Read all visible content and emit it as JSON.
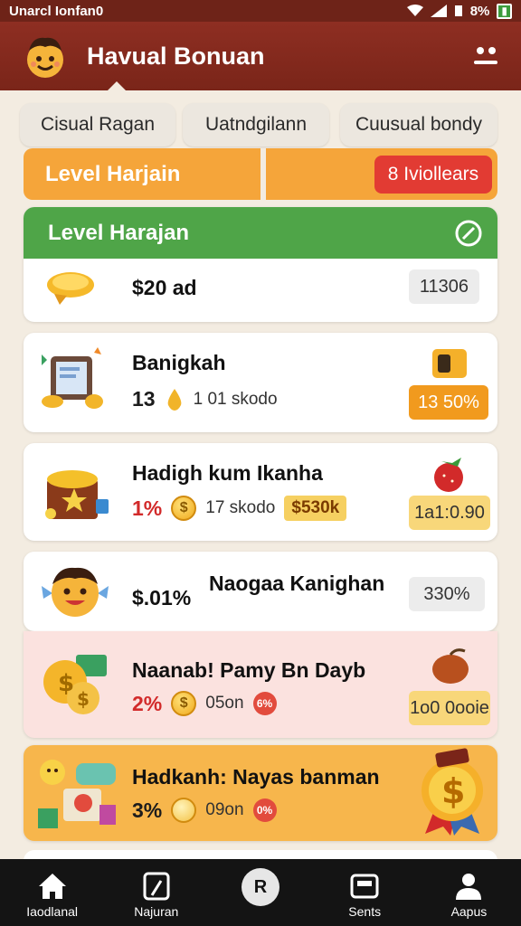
{
  "status_bar": {
    "carrier": "Unarcl Ionfan0",
    "battery": "8%"
  },
  "app": {
    "title": "Havual Bonuan"
  },
  "tabs": [
    "Cisual Ragan",
    "Uatndgilann",
    "Cuusual bondy"
  ],
  "level_bar": {
    "label": "Level Harjain",
    "badge": "8 Iviollears"
  },
  "cards": [
    {
      "header": "Level Harajan",
      "value": "$20 ad",
      "pill": "11306"
    },
    {
      "title": "Banigkah",
      "big": "13",
      "small": "1 01 skodo",
      "pill": "13 50%"
    },
    {
      "title": "Hadigh kum Ikanha",
      "big": "1%",
      "small": "17 skodo",
      "tag": "$530k",
      "pill": "1a1:0.90"
    },
    {
      "title": "Naogaa Kanighan",
      "big": "$.01%",
      "pill": "330%"
    },
    {
      "title": "Naanab! Pamy Bn Dayb",
      "big": "2%",
      "small": "05on",
      "circle": "6%",
      "pill": "1o0 0ooie"
    },
    {
      "title": "Hadkanh: Nayas banman",
      "big": "3%",
      "small": "09on",
      "circle": "0%"
    }
  ],
  "bottom_nav": [
    "Iaodlanal",
    "Najuran",
    "Sents",
    "Aapus"
  ],
  "nav_center_glyph": "R",
  "colors": {
    "header": "#7a2519",
    "orange": "#f5a53a",
    "green": "#4fa548",
    "red_badge": "#e23b33",
    "nav_bg": "#141414"
  }
}
